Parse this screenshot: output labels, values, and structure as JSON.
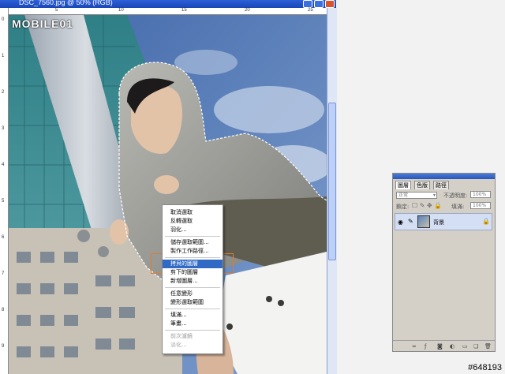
{
  "window": {
    "title": "DSC_7560.jpg @ 50% (RGB)",
    "logo": "MOBILE01"
  },
  "rulers": {
    "top": [
      "5",
      "10",
      "15",
      "20",
      "25"
    ],
    "left": [
      "0",
      "1",
      "2",
      "3",
      "4",
      "5",
      "6",
      "7",
      "8",
      "9"
    ]
  },
  "context_menu": {
    "items": [
      {
        "label": "取消選取",
        "disabled": false
      },
      {
        "label": "反轉選取",
        "disabled": false
      },
      {
        "label": "羽化...",
        "disabled": false
      },
      {
        "label": "儲存選取範圍...",
        "disabled": false
      },
      {
        "label": "製作工作路徑...",
        "disabled": false
      },
      {
        "label": "拷貝的圖層",
        "disabled": false,
        "selected": true
      },
      {
        "label": "剪下的圖層",
        "disabled": false
      },
      {
        "label": "新增圖層...",
        "disabled": false
      },
      {
        "label": "任意變形",
        "disabled": false
      },
      {
        "label": "變形選取範圍",
        "disabled": false
      },
      {
        "label": "填滿...",
        "disabled": false
      },
      {
        "label": "筆畫...",
        "disabled": false
      },
      {
        "label": "前次濾鏡",
        "disabled": true
      },
      {
        "label": "淡化...",
        "disabled": true
      }
    ]
  },
  "layers_panel": {
    "tabs": [
      "圖層",
      "色版",
      "路徑"
    ],
    "blend_mode": "正常",
    "opacity_label": "不透明度:",
    "opacity_value": "100%",
    "lock_label": "鎖定:",
    "fill_label": "填滿:",
    "fill_value": "100%",
    "layer_name": "背景"
  },
  "watermark": "#648193"
}
